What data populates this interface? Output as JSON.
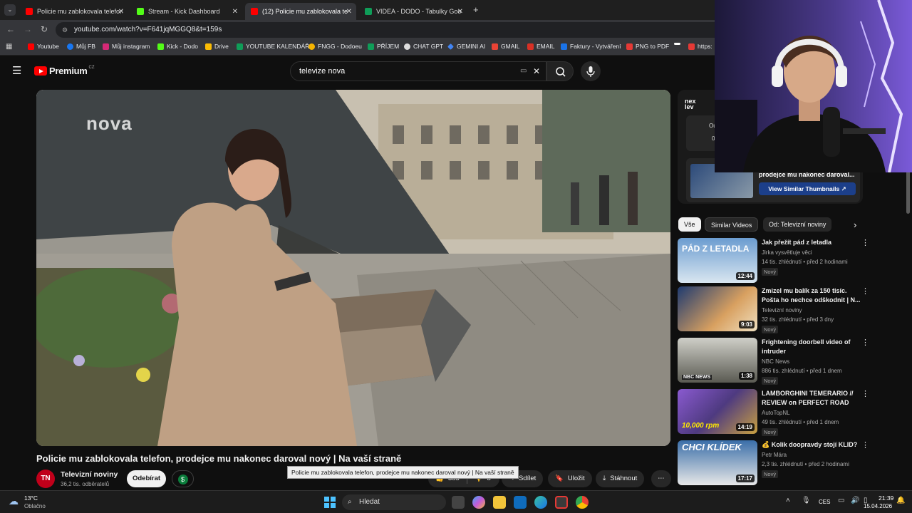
{
  "browser": {
    "tabs": [
      {
        "label": "Policie mu zablokovala telefon,",
        "favicon_color": "#ff0000"
      },
      {
        "label": "Stream - Kick Dashboard",
        "favicon_color": "#53fc18"
      },
      {
        "label": "(12) Policie mu zablokovala tele",
        "favicon_color": "#ff0000"
      },
      {
        "label": "VIDEA - DODO - Tabulky Googl",
        "favicon_color": "#0f9d58"
      }
    ],
    "url": "youtube.com/watch?v=F641jqMGGQ8&t=159s",
    "bookmarks": [
      "Youtube",
      "Můj FB",
      "Můj instagram",
      "Kick - Dodo",
      "Drive",
      "YOUTUBE KALENDÁŘ",
      "FNGG - Dodoeu",
      "PŘÍJEM",
      "CHAT GPT",
      "GEMINI AI",
      "GMAIL",
      "EMAIL",
      "Faktury - Vytváření",
      "PNG to PDF",
      "",
      "https:"
    ]
  },
  "youtube": {
    "logo": "Premium",
    "logo_region": "CZ",
    "search_query": "televize nova",
    "video": {
      "watermark": "nova",
      "title": "Policie mu zablokovala telefon, prodejce mu nakonec daroval nový | Na vaší straně",
      "tooltip": "Policie mu zablokovala telefon, prodejce mu nakonec daroval nový | Na vaší straně",
      "channel_name": "Televizní noviny",
      "channel_initials": "TN",
      "subscribers": "36,2 tis. odběratelů",
      "subscribe_label": "Odebírat",
      "likes": "385",
      "dislikes": "8",
      "share_label": "Sdílet",
      "save_label": "Uložit",
      "download_label": "Stáhnout"
    },
    "extension": {
      "logo": "nex lev",
      "title_fragment": "prodejce mu nakonec daroval...",
      "button": "View Similar Thumbnails",
      "panel_letters": [
        "Ou",
        "0"
      ]
    },
    "chips": [
      "Vše",
      "Similar Videos",
      "Od: Televizní noviny"
    ],
    "recommendations": [
      {
        "title": "Jak přežít pád z letadla",
        "channel": "Jirka vysvětluje věci",
        "meta": "14 tis. zhlédnutí • před 2 hodinami",
        "duration": "12:44",
        "badge": "Nový",
        "thumb_text": "PÁD Z LETADLA",
        "thumb_color": "#5a8fbf"
      },
      {
        "title": "Zmizel mu balík za 150 tisíc. Pošta ho nechce odškodnit | N...",
        "channel": "Televizní noviny",
        "meta": "32 tis. zhlédnutí • před 3 dny",
        "duration": "9:03",
        "badge": "Nový",
        "thumb_text": "",
        "thumb_color": "#b4824a"
      },
      {
        "title": "Frightening doorbell video of intruder",
        "channel": "NBC News",
        "meta": "886 tis. zhlédnutí • před 1 dnem",
        "duration": "1:38",
        "badge": "Nový",
        "thumb_text": "NBC NEWS",
        "thumb_color": "#6e6e64"
      },
      {
        "title": "LAMBORGHINI TEMERARIO // REVIEW on PERFECT ROAD",
        "channel": "AutoTopNL",
        "meta": "49 tis. zhlédnutí • před 1 dnem",
        "duration": "14:19",
        "badge": "Nový",
        "thumb_text": "10,000 rpm",
        "thumb_color": "#7a5ab0"
      },
      {
        "title": "Kolik doopravdy stojí KLID?",
        "channel": "Petr Mára",
        "meta": "2,3 tis. zhlédnutí • před 2 hodinami",
        "duration": "17:17",
        "badge": "Nový",
        "thumb_text": "CHCI KLÍDEK",
        "thumb_color": "#3a6ea8"
      }
    ]
  },
  "taskbar": {
    "temperature": "13°C",
    "weather": "Oblačno",
    "search_placeholder": "Hledat",
    "language": "CES",
    "time": "21:39",
    "date": "15.04.2026"
  }
}
